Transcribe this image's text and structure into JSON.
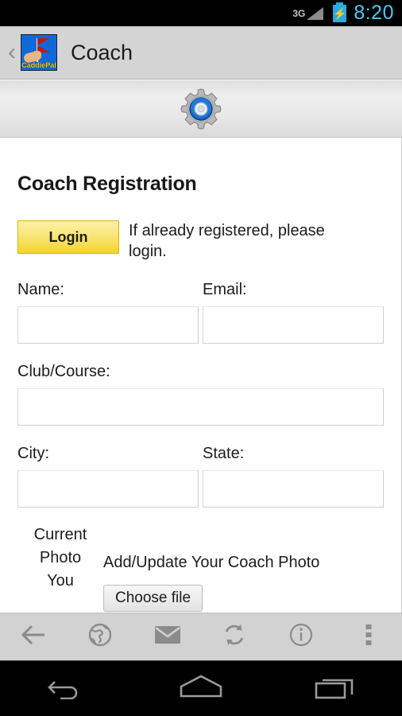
{
  "status_bar": {
    "network": "3G",
    "time": "8:20",
    "signal_icon": "signal-bars-icon",
    "battery_icon": "battery-charging-icon",
    "time_color": "#52c7f0"
  },
  "action_bar": {
    "back_glyph": "‹",
    "app_icon_name": "caddiepal-app-icon",
    "app_brand": "CaddiePal",
    "title": "Coach"
  },
  "gear_band": {
    "icon": "gear-icon"
  },
  "page": {
    "title": "Coach Registration",
    "login_button": "Login",
    "login_note": "If already registered, please login.",
    "fields": [
      {
        "label": "Name:",
        "value": "",
        "placeholder": "",
        "name": "name-field"
      },
      {
        "label": "Email:",
        "value": "",
        "placeholder": "",
        "name": "email-field"
      },
      {
        "label": "Club/Course:",
        "value": "",
        "placeholder": "",
        "name": "club-course-field"
      },
      {
        "label": "City:",
        "value": "",
        "placeholder": "",
        "name": "city-field"
      },
      {
        "label": "State:",
        "value": "",
        "placeholder": "",
        "name": "state-field"
      }
    ],
    "photo": {
      "current_photo_label": "Current Photo",
      "you_label": "You",
      "caption": "Add/Update Your Coach Photo",
      "choose_file_button": "Choose file"
    }
  },
  "toolbar": {
    "items": [
      {
        "name": "back-icon",
        "label": "Back"
      },
      {
        "name": "globe-icon",
        "label": "Browser"
      },
      {
        "name": "envelope-icon",
        "label": "Mail"
      },
      {
        "name": "refresh-icon",
        "label": "Refresh"
      },
      {
        "name": "info-icon",
        "label": "Info"
      },
      {
        "name": "overflow-menu-icon",
        "label": "More"
      }
    ]
  },
  "nav_bar": {
    "items": [
      {
        "name": "nav-back-icon",
        "label": "Back"
      },
      {
        "name": "nav-home-icon",
        "label": "Home"
      },
      {
        "name": "nav-recents-icon",
        "label": "Recents"
      }
    ]
  }
}
